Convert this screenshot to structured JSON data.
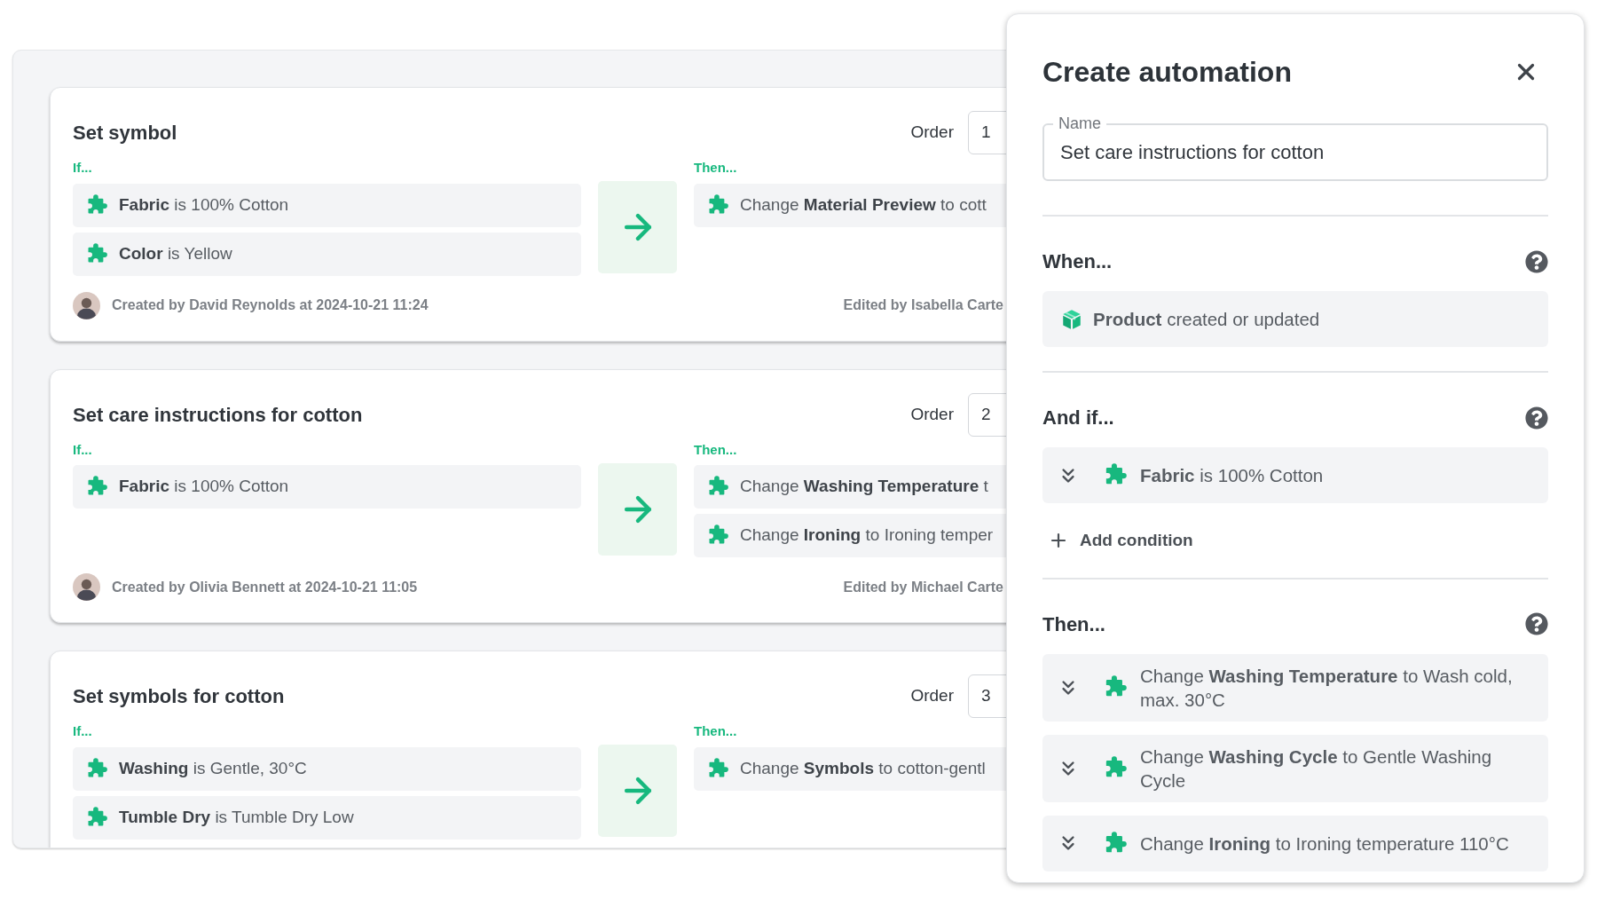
{
  "rules": [
    {
      "title": "Set symbol",
      "order_label": "Order",
      "order": "1",
      "if_label": "If...",
      "conditions": [
        "**Fabric** is 100% Cotton",
        "**Color** is Yellow"
      ],
      "then_label": "Then...",
      "actions": [
        "Change **Material Preview** to cott"
      ],
      "created": "Created by David Reynolds at 2024-10-21 11:24",
      "edited": "Edited by Isabella Carte"
    },
    {
      "title": "Set care instructions for cotton",
      "order_label": "Order",
      "order": "2",
      "if_label": "If...",
      "conditions": [
        "**Fabric** is 100% Cotton"
      ],
      "then_label": "Then...",
      "actions": [
        "Change **Washing Temperature** t",
        "Change **Ironing** to Ironing temper"
      ],
      "created": "Created by Olivia Bennett at 2024-10-21 11:05",
      "edited": "Edited by Michael Carte"
    },
    {
      "title": "Set symbols for cotton",
      "order_label": "Order",
      "order": "3",
      "if_label": "If...",
      "conditions": [
        "**Washing** is Gentle, 30°C",
        "**Tumble Dry** is Tumble Dry Low"
      ],
      "then_label": "Then...",
      "actions": [
        "Change **Symbols** to cotton-gentl"
      ]
    }
  ],
  "dialog": {
    "title": "Create automation",
    "name_field": {
      "label": "Name",
      "value": "Set care instructions for cotton"
    },
    "sections": [
      {
        "heading": "When...",
        "items": [
          {
            "kind": "trigger",
            "text": "**Product** created or updated"
          }
        ]
      },
      {
        "heading": "And if...",
        "items": [
          {
            "kind": "step",
            "text": "**Fabric** is 100% Cotton"
          }
        ],
        "add_button": "Add condition"
      },
      {
        "heading": "Then...",
        "items": [
          {
            "kind": "step",
            "text": "Change **Washing Temperature** to Wash cold, max. 30°C"
          },
          {
            "kind": "step",
            "text": "Change **Washing Cycle** to Gentle Washing Cycle"
          },
          {
            "kind": "step",
            "text": "Change **Ironing** to Ironing temperature 110°C"
          }
        ]
      }
    ]
  }
}
